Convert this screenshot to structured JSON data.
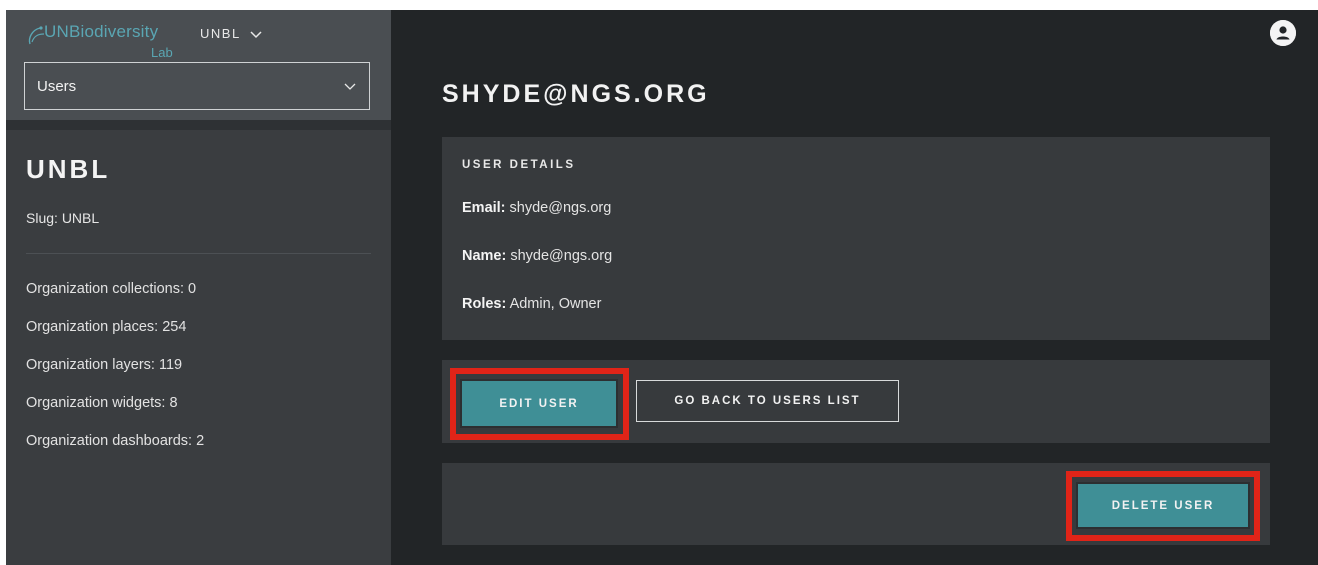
{
  "colors": {
    "app_bg": "#222527",
    "sidebar_bg": "#3a3d40",
    "panel_bg": "#373a3d",
    "accent": "#3f8f96",
    "highlight": "#e02418",
    "brand": "#5aa6b3"
  },
  "header": {
    "logo_text": "UNBiodiversity",
    "logo_subtext": "Lab",
    "org_switch_label": "UNBL",
    "org_switch_icon": "chevron-down-icon",
    "section_select_value": "Users",
    "avatar_icon": "user-icon"
  },
  "sidebar": {
    "org_name": "UNBL",
    "slug_label": "Slug:",
    "slug_value": "UNBL",
    "stats": [
      {
        "label": "Organization collections:",
        "value": "0"
      },
      {
        "label": "Organization places:",
        "value": "254"
      },
      {
        "label": "Organization layers:",
        "value": "119"
      },
      {
        "label": "Organization widgets:",
        "value": "8"
      },
      {
        "label": "Organization dashboards:",
        "value": "2"
      }
    ]
  },
  "main": {
    "title": "SHYDE@NGS.ORG",
    "details": {
      "heading": "USER DETAILS",
      "email_label": "Email:",
      "email_value": "shyde@ngs.org",
      "name_label": "Name:",
      "name_value": "shyde@ngs.org",
      "roles_label": "Roles:",
      "roles_value": "Admin, Owner"
    },
    "actions": {
      "edit_label": "EDIT USER",
      "back_label": "GO BACK TO USERS LIST",
      "delete_label": "DELETE USER"
    }
  }
}
